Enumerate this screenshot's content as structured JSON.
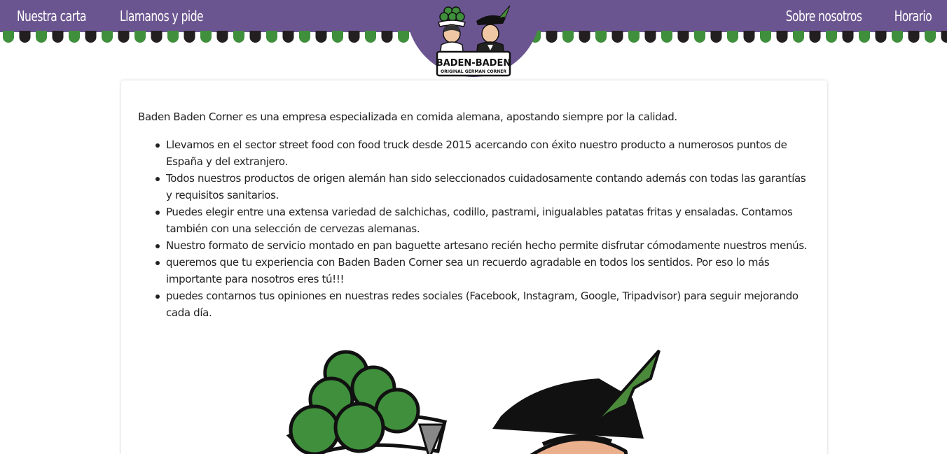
{
  "nav": {
    "left": [
      "Nuestra carta",
      "Llamanos y pide"
    ],
    "right": [
      "Sobre nosotros",
      "Horario"
    ]
  },
  "logo": {
    "title": "BADEN-BADEN",
    "subtitle": "ORIGINAL GERMAN CORNER"
  },
  "content": {
    "intro": "Baden Baden Corner es una empresa especializada en comida alemana, apostando siempre por la calidad.",
    "bullets": [
      "Llevamos en el sector street food con food truck desde 2015 acercando con éxito nuestro producto a numerosos puntos de España y del extranjero.",
      "Todos nuestros productos de origen alemán han sido seleccionados cuidadosamente contando además con todas las garantías y requisitos sanitarios.",
      "Puedes elegir entre una extensa variedad de salchichas, codillo, pastrami, inigualables patatas fritas y ensaladas. Contamos también con una selección de cervezas alemanas.",
      "Nuestro formato de servicio montado en pan baguette artesano recién hecho permite disfrutar cómodamente nuestros menús.",
      "queremos que tu experiencia con Baden Baden Corner sea un recuerdo agradable en todos los sentidos. Por eso lo más importante para nosotros eres tú!!!",
      "puedes contarnos tus opiniones en nuestras redes sociales (Facebook, Instagram, Google, Tripadvisor) para seguir mejorando cada día."
    ]
  },
  "colors": {
    "brand_purple": "#6b5590",
    "scallop_green": "#3f8f3c",
    "scallop_dark": "#231f20",
    "hat_green": "#4a8a3a"
  }
}
